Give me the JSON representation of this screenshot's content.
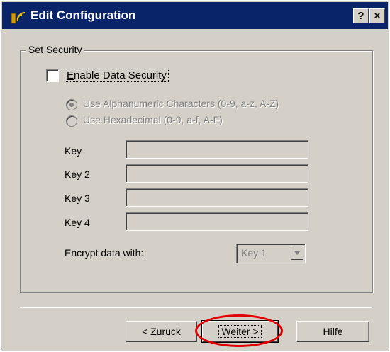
{
  "window": {
    "title": "Edit Configuration",
    "help_glyph": "?",
    "close_glyph": "×"
  },
  "group": {
    "legend": "Set Security"
  },
  "security": {
    "enable_label": "Enable Data Security",
    "enable_checked": false,
    "radio_alnum": "Use Alphanumeric Characters (0-9, a-z, A-Z)",
    "radio_hex": "Use Hexadecimal (0-9, a-f, A-F)",
    "selected_radio": "alnum"
  },
  "keys": [
    {
      "label": "Key",
      "value": ""
    },
    {
      "label": "Key 2",
      "value": ""
    },
    {
      "label": "Key 3",
      "value": ""
    },
    {
      "label": "Key 4",
      "value": ""
    }
  ],
  "encrypt": {
    "label": "Encrypt data with:",
    "selected": "Key 1"
  },
  "buttons": {
    "back": "< Zurück",
    "next": "Weiter >",
    "help": "Hilfe"
  },
  "colors": {
    "titlebar": "#0a246a",
    "face": "#d4d0c8",
    "highlight_ring": "#e00000"
  },
  "icons": [
    "wireless-icon",
    "help-icon",
    "close-icon",
    "chevron-down-icon"
  ]
}
